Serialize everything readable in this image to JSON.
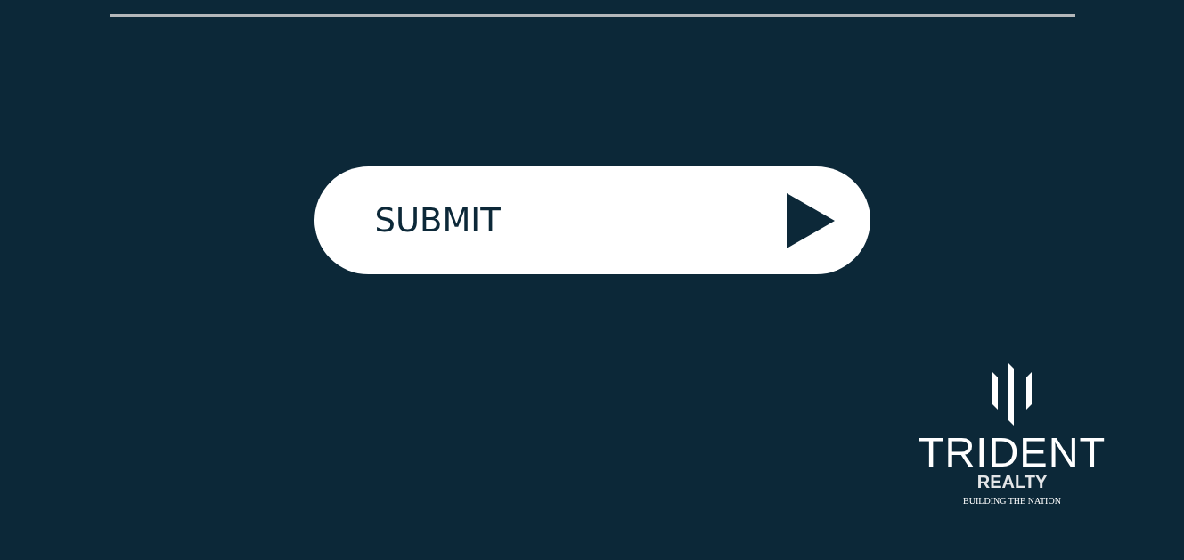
{
  "form": {
    "submit_button": {
      "label": "SUBMIT"
    }
  },
  "logo": {
    "name": "TRIDENT",
    "subtitle": "REALTY",
    "tagline": "BUILDING THE NATION"
  }
}
